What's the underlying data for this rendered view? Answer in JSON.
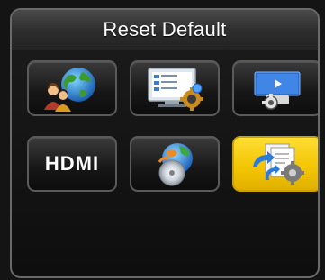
{
  "menu": {
    "title": "Reset Default",
    "tiles": [
      {
        "id": "language",
        "icon": "globe-people-icon"
      },
      {
        "id": "display",
        "icon": "monitor-settings-icon"
      },
      {
        "id": "projector",
        "icon": "projector-gear-icon"
      },
      {
        "id": "hdmi",
        "icon": "hdmi-logo",
        "label": "HDMI"
      },
      {
        "id": "system",
        "icon": "globe-disc-icon"
      },
      {
        "id": "reset-default",
        "icon": "documents-reset-icon",
        "selected": true
      }
    ]
  },
  "colors": {
    "selected": "#f2c400",
    "tile_border": "#5a5a5a",
    "title_text": "#ffffff"
  }
}
